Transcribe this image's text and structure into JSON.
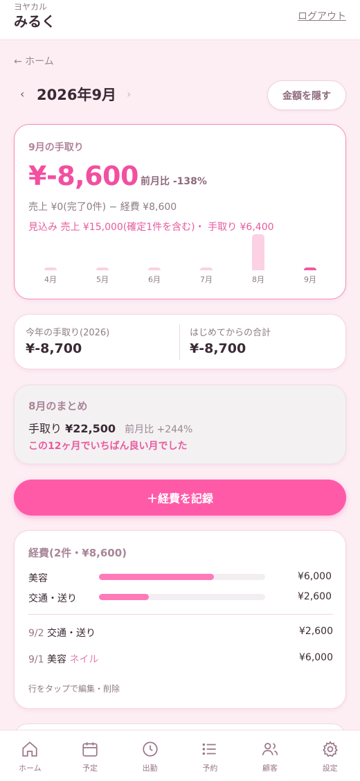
{
  "header": {
    "app_sub": "ヨヤカル",
    "app_name": "みるく",
    "logout": "ログアウト"
  },
  "nav": {
    "back": "← ホーム"
  },
  "month": {
    "prev": "‹",
    "title": "2026年9月",
    "next": "›",
    "hide_amounts": "金額を隠す"
  },
  "income_card": {
    "title": "9月の手取り",
    "amount": "¥-8,600",
    "mom": "前月比 -138%",
    "detail": "売上 ¥0(完了0件) − 経費 ¥8,600",
    "forecast": "見込み 売上 ¥15,000(確定1件を含む)・ 手取り ¥6,400"
  },
  "chart_data": {
    "type": "bar",
    "categories": [
      "4月",
      "5月",
      "6月",
      "7月",
      "8月",
      "9月"
    ],
    "values": [
      0,
      0,
      0,
      0,
      22500,
      0
    ],
    "highlight": "9月",
    "colors": {
      "bar": "#fbd1e3",
      "current": "#f05aa0"
    }
  },
  "totals": {
    "year_label": "今年の手取り(2026)",
    "year_value": "¥-8,700",
    "all_label": "はじめてからの合計",
    "all_value": "¥-8,700"
  },
  "summary": {
    "title": "8月のまとめ",
    "label": "手取り",
    "value": "¥22,500",
    "mom": "前月比 +244%",
    "note": "この12ヶ月でいちばん良い月でした"
  },
  "record_button": "＋経費を記録",
  "expenses": {
    "title": "経費(2件・¥8,600)",
    "categories": [
      {
        "label": "美容",
        "amount": "¥6,000",
        "ratio": 0.69
      },
      {
        "label": "交通・送り",
        "amount": "¥2,600",
        "ratio": 0.3
      }
    ],
    "rows": [
      {
        "date": "9/2",
        "category": "交通・送り",
        "memo": "",
        "amount": "¥2,600"
      },
      {
        "date": "9/1",
        "category": "美容",
        "memo": "ネイル",
        "amount": "¥6,000"
      }
    ],
    "hint": "行をタップで編集・削除"
  },
  "bottom_nav": [
    {
      "label": "ホーム",
      "icon": "home-icon"
    },
    {
      "label": "予定",
      "icon": "calendar-icon"
    },
    {
      "label": "出勤",
      "icon": "clock-icon"
    },
    {
      "label": "予約",
      "icon": "list-icon"
    },
    {
      "label": "顧客",
      "icon": "users-icon"
    },
    {
      "label": "設定",
      "icon": "gear-icon"
    }
  ],
  "colors": {
    "accent": "#ff5aa8",
    "accent_text": "#f24fa0",
    "background": "#fdeef4"
  }
}
